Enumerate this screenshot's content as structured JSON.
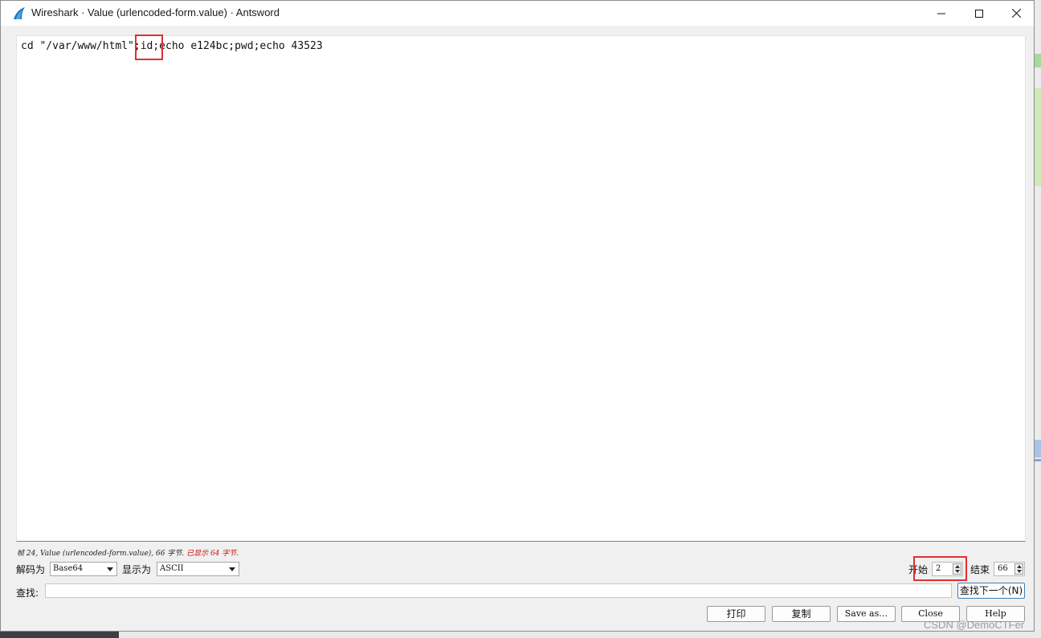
{
  "window": {
    "title": "Wireshark · Value (urlencoded-form.value) · Antsword"
  },
  "content": {
    "text": "cd \"/var/www/html\";id;echo e124bc;pwd;echo 43523"
  },
  "status": {
    "info": "帧 24, Value (urlencoded-form.value), 66 字节.",
    "shown": "已显示 64 字节."
  },
  "controls": {
    "decode_as_label": "解码为",
    "decode_as_value": "Base64",
    "show_as_label": "显示为",
    "show_as_value": "ASCII",
    "start_label": "开始",
    "start_value": "2",
    "end_label": "结束",
    "end_value": "66"
  },
  "find": {
    "label": "查找:",
    "value": "",
    "find_next_label": "查找下一个(N)"
  },
  "buttons": {
    "print": "打印",
    "copy": "复制",
    "save_as": "Save as…",
    "close": "Close",
    "help": "Help"
  },
  "watermark": "CSDN @DemoCTFer",
  "colors": {
    "highlight_box": "#e03030",
    "status_red": "#d01010",
    "focus_blue": "#4d8fc9"
  }
}
